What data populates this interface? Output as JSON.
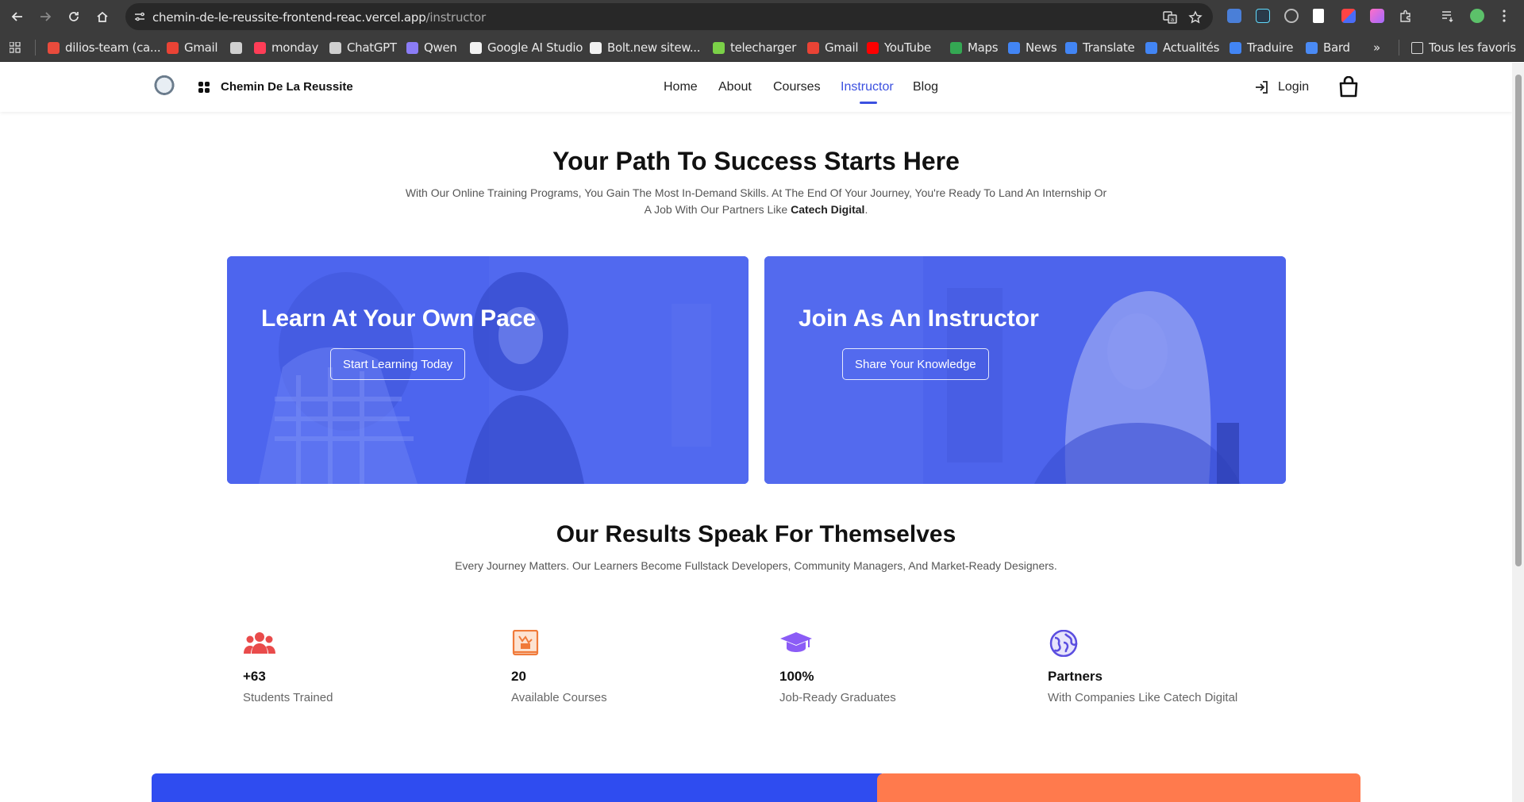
{
  "browser": {
    "url_host": "chemin-de-le-reussite-frontend-reac.vercel.app",
    "url_path": "/instructor",
    "bookmarks": [
      {
        "label": "dilios-team (ca...",
        "color": "#e94b3c"
      },
      {
        "label": "Gmail",
        "color": "#ea4335"
      },
      {
        "label": "",
        "color": "#d0d0d0"
      },
      {
        "label": "monday",
        "color": "#ff3d57"
      },
      {
        "label": "ChatGPT",
        "color": "#cfcfcf"
      },
      {
        "label": "Qwen",
        "color": "#8b7cf6"
      },
      {
        "label": "Google AI Studio",
        "color": "#f2f2f2"
      },
      {
        "label": "Bolt.new sitew...",
        "color": "#f2f2f2"
      },
      {
        "label": "telecharger",
        "color": "#7bd148"
      },
      {
        "label": "Gmail",
        "color": "#ea4335"
      },
      {
        "label": "YouTube",
        "color": "#ff0000"
      },
      {
        "label": "Maps",
        "color": "#34a853"
      },
      {
        "label": "News",
        "color": "#4285f4"
      },
      {
        "label": "Translate",
        "color": "#4285f4"
      },
      {
        "label": "Actualités",
        "color": "#4285f4"
      },
      {
        "label": "Traduire",
        "color": "#4285f4"
      },
      {
        "label": "Bard",
        "color": "#4a8af4"
      }
    ],
    "more_bookmarks": "»",
    "all_bookmarks": "Tous les favoris"
  },
  "header": {
    "brand": "Chemin De La Reussite",
    "menu": [
      {
        "label": "Home"
      },
      {
        "label": "About"
      },
      {
        "label": "Courses"
      },
      {
        "label": "Instructor"
      },
      {
        "label": "Blog"
      }
    ],
    "active_menu": "Instructor",
    "login": "Login"
  },
  "hero": {
    "title": "Your Path To Success Starts Here",
    "subtitle_part1": "With Our Online Training Programs, You Gain The Most In-Demand Skills. At The End Of Your Journey, You're Ready To Land An Internship Or A Job With Our Partners Like ",
    "subtitle_bold": "Catech Digital",
    "subtitle_end": "."
  },
  "cards": [
    {
      "title": "Learn At Your Own Pace",
      "button": "Start Learning Today"
    },
    {
      "title": "Join As An Instructor",
      "button": "Share Your Knowledge"
    }
  ],
  "results": {
    "title": "Our Results Speak For Themselves",
    "subtitle": "Every Journey Matters. Our Learners Become Fullstack Developers, Community Managers, And Market-Ready Designers.",
    "stats": [
      {
        "value": "+63",
        "label": "Students Trained",
        "icon": "users-icon",
        "color": "#e94b4b"
      },
      {
        "value": "20",
        "label": "Available Courses",
        "icon": "book-icon",
        "color": "#f07a3a"
      },
      {
        "value": "100%",
        "label": "Job-Ready Graduates",
        "icon": "graduation-cap-icon",
        "color": "#8b5cf6"
      },
      {
        "value": "Partners",
        "label": "With Companies Like Catech Digital",
        "icon": "globe-icon",
        "color": "#5b4ee0"
      }
    ]
  },
  "colors": {
    "accent": "#3b50e0",
    "card_overlay": "#4b63ec",
    "band_blue": "#2f4cf0",
    "band_orange": "#ff7a4d"
  }
}
